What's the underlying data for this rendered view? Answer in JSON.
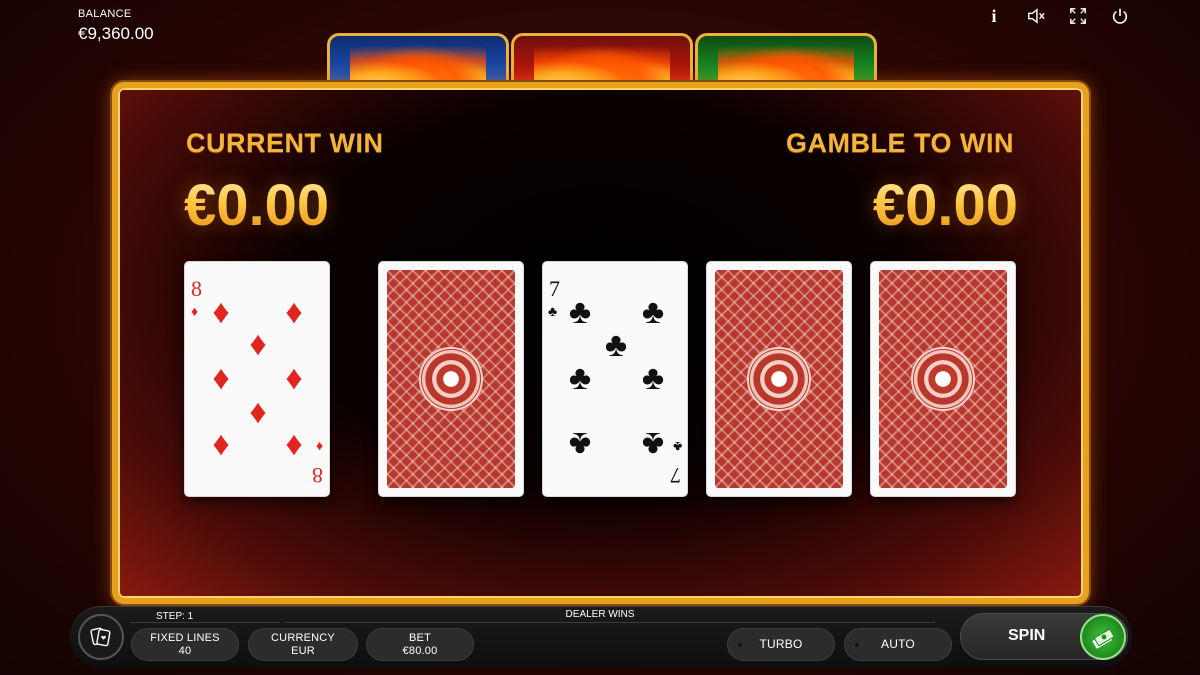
{
  "balance": {
    "label": "BALANCE",
    "value": "€9,360.00"
  },
  "top_icons": [
    "info-icon",
    "sound-muted-icon",
    "fullscreen-icon",
    "power-icon"
  ],
  "info_glyph": "i",
  "flame_tabs": [
    "blue",
    "red",
    "green"
  ],
  "gamble": {
    "current_win_label": "CURRENT WIN",
    "current_win_value": "€0.00",
    "gamble_to_win_label": "GAMBLE TO WIN",
    "gamble_to_win_value": "€0.00"
  },
  "cards": [
    {
      "face": "up",
      "rank": "8",
      "suit": "diamonds",
      "symbol": "♦",
      "color": "red"
    },
    {
      "face": "down"
    },
    {
      "face": "up",
      "rank": "7",
      "suit": "clubs",
      "symbol": "♣",
      "color": "black"
    },
    {
      "face": "down"
    },
    {
      "face": "down"
    }
  ],
  "status": {
    "step": "STEP: 1",
    "message": "DEALER WINS"
  },
  "controls": {
    "fixed_lines_label": "FIXED LINES",
    "fixed_lines_value": "40",
    "currency_label": "CURRENCY",
    "currency_value": "EUR",
    "bet_label": "BET",
    "bet_value": "€80.00",
    "turbo_label": "TURBO",
    "auto_label": "AUTO",
    "spin_label": "SPIN"
  },
  "colors": {
    "gold": "#f3b43a",
    "panel_border": "#e6a21e",
    "collect_green": "#2fa62a",
    "card_red": "#e0261f"
  }
}
